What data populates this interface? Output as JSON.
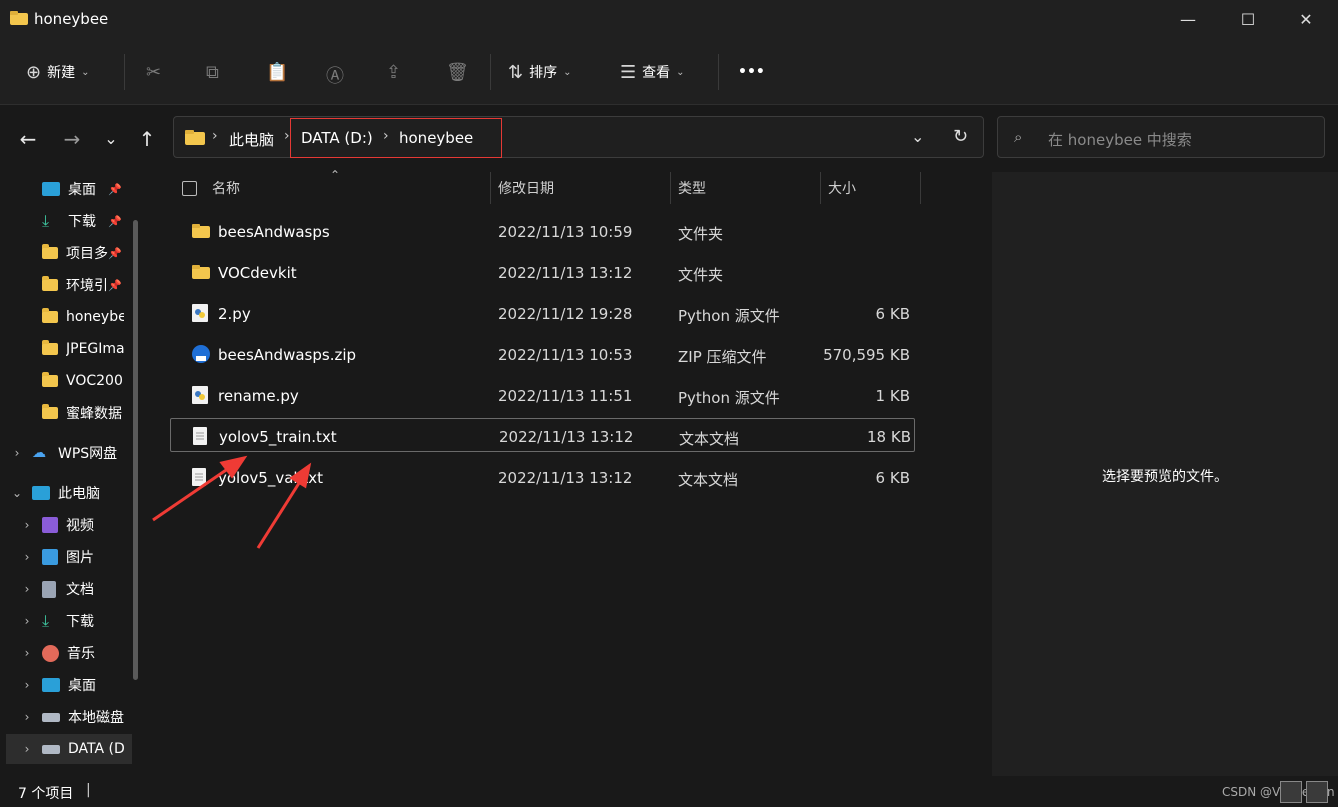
{
  "window": {
    "title": "honeybee",
    "minimize": "—",
    "maximize": "☐",
    "close": "✕"
  },
  "toolbar": {
    "new_label": "新建",
    "sort_label": "排序",
    "view_label": "查看",
    "more_label": "•••"
  },
  "address": {
    "crumbs": [
      "此电脑",
      "DATA (D:)",
      "honeybee"
    ]
  },
  "search": {
    "placeholder": "在 honeybee 中搜索"
  },
  "sidebar": {
    "quick": [
      {
        "label": "桌面",
        "pinned": true
      },
      {
        "label": "下载",
        "pinned": true
      },
      {
        "label": "项目多",
        "pinned": true
      },
      {
        "label": "环境引",
        "pinned": true
      },
      {
        "label": "honeybee",
        "pinned": false
      },
      {
        "label": "JPEGIma",
        "pinned": false
      },
      {
        "label": "VOC200",
        "pinned": false
      },
      {
        "label": "蜜蜂数据",
        "pinned": false
      }
    ],
    "wps": "WPS网盘",
    "thispc": "此电脑",
    "pc_items": [
      "视频",
      "图片",
      "文档",
      "下载",
      "音乐",
      "桌面",
      "本地磁盘",
      "DATA (D"
    ]
  },
  "columns": {
    "name": "名称",
    "date": "修改日期",
    "type": "类型",
    "size": "大小"
  },
  "files": [
    {
      "name": "beesAndwasps",
      "date": "2022/11/13 10:59",
      "type": "文件夹",
      "size": "",
      "icon": "folder-icon"
    },
    {
      "name": "VOCdevkit",
      "date": "2022/11/13 13:12",
      "type": "文件夹",
      "size": "",
      "icon": "folder-icon"
    },
    {
      "name": "2.py",
      "date": "2022/11/12 19:28",
      "type": "Python 源文件",
      "size": "6 KB",
      "icon": "python-file-icon"
    },
    {
      "name": "beesAndwasps.zip",
      "date": "2022/11/13 10:53",
      "type": "ZIP 压缩文件",
      "size": "570,595 KB",
      "icon": "zip-file-icon"
    },
    {
      "name": "rename.py",
      "date": "2022/11/13 11:51",
      "type": "Python 源文件",
      "size": "1 KB",
      "icon": "python-file-icon"
    },
    {
      "name": "yolov5_train.txt",
      "date": "2022/11/13 13:12",
      "type": "文本文档",
      "size": "18 KB",
      "icon": "text-file-icon"
    },
    {
      "name": "yolov5_val.txt",
      "date": "2022/11/13 13:12",
      "type": "文本文档",
      "size": "6 KB",
      "icon": "text-file-icon"
    }
  ],
  "preview": {
    "message": "选择要预览的文件。"
  },
  "status": {
    "count": "7 个项目",
    "watermark": "CSDN @VagueMan"
  },
  "colors": {
    "highlight": "#e53935",
    "folder": "#f3c64d",
    "bg": "#191919"
  }
}
